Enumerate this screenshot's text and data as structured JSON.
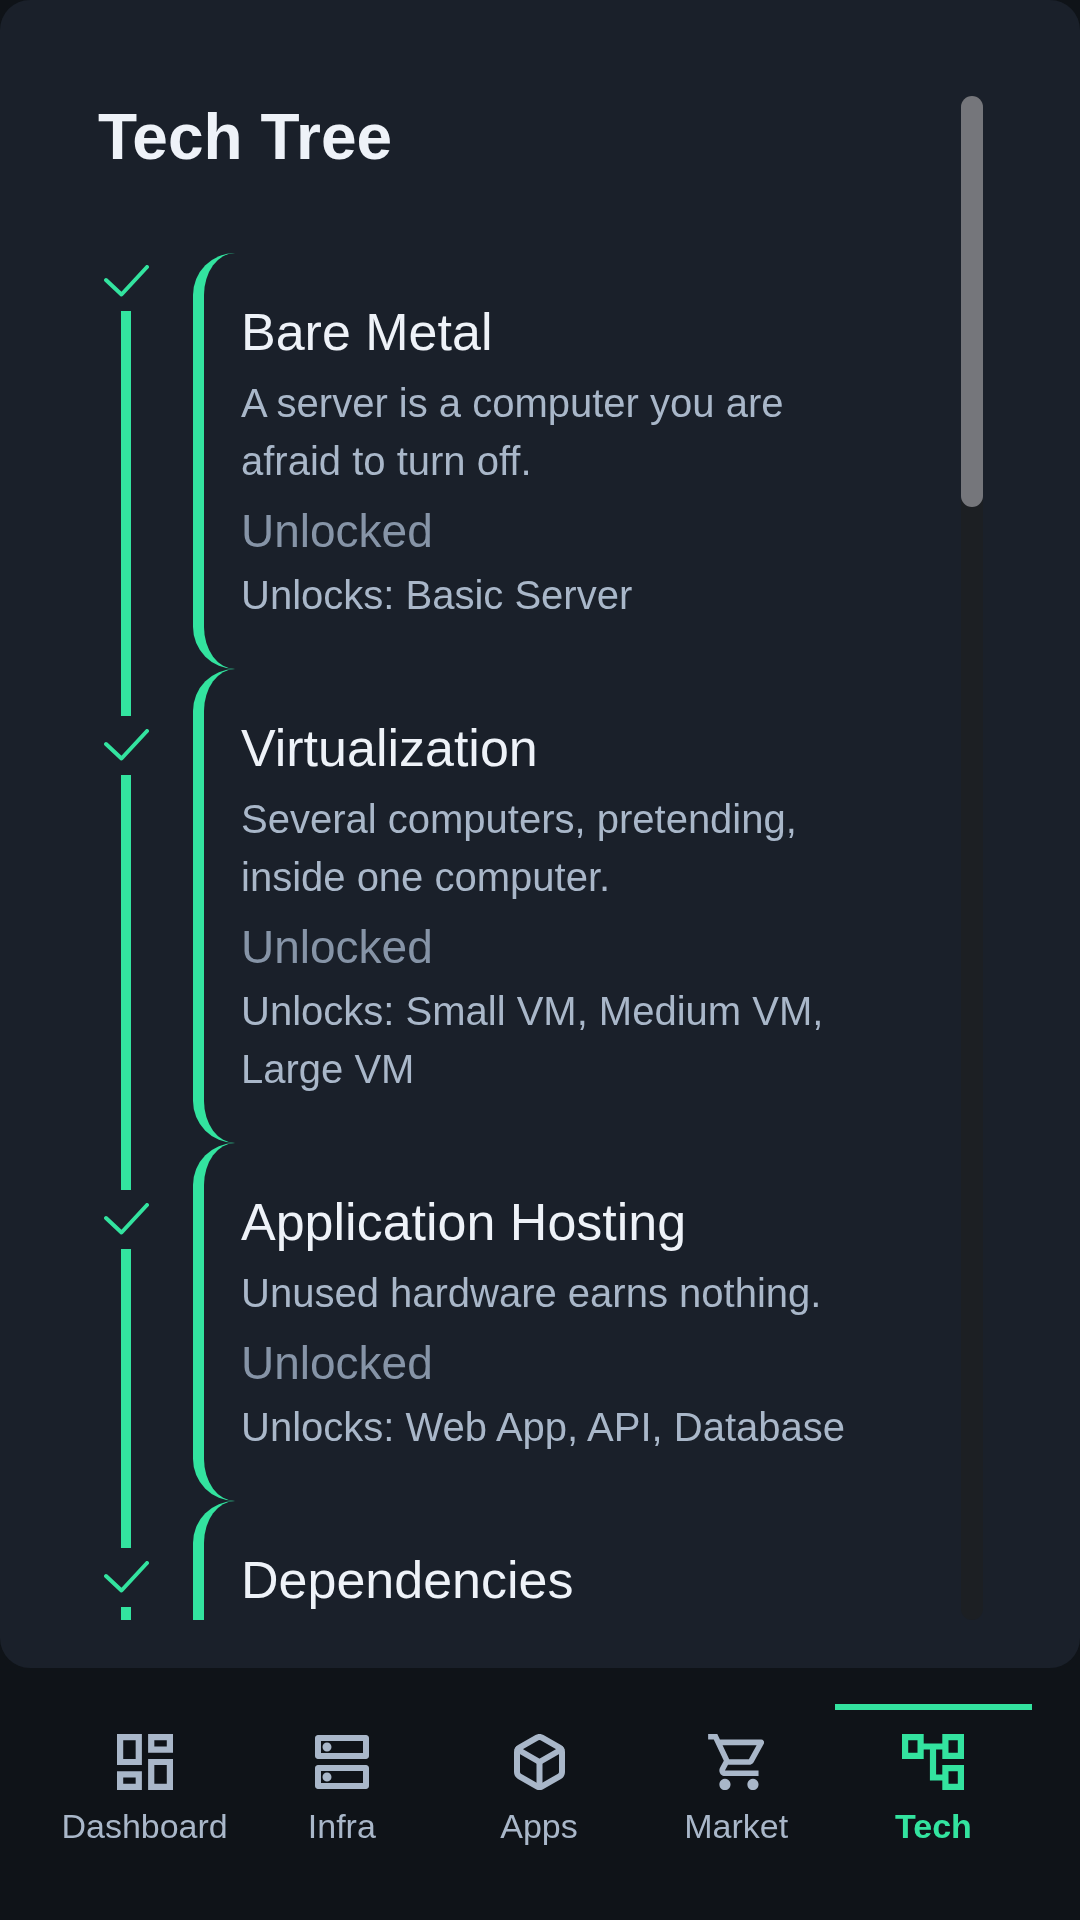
{
  "screen": {
    "title": "Tech Tree"
  },
  "tech_tree": [
    {
      "name": "Bare Metal",
      "unlocked": true,
      "description": "A server is a computer you are afraid to turn off.",
      "status": "Unlocked",
      "unlocks": "Unlocks: Basic Server"
    },
    {
      "name": "Virtualization",
      "unlocked": true,
      "description": "Several computers, pretending, inside one computer.",
      "status": "Unlocked",
      "unlocks": "Unlocks: Small VM, Medium VM, Large VM"
    },
    {
      "name": "Application Hosting",
      "unlocked": true,
      "description": "Unused hardware earns nothing.",
      "status": "Unlocked",
      "unlocks": "Unlocks: Web App, API, Database"
    },
    {
      "name": "Dependencies",
      "unlocked": true
    }
  ],
  "bottom_nav": [
    {
      "label": "Dashboard",
      "selected": false
    },
    {
      "label": "Infra",
      "selected": false
    },
    {
      "label": "Apps",
      "selected": false
    },
    {
      "label": "Market",
      "selected": false
    },
    {
      "label": "Tech",
      "selected": true
    }
  ]
}
